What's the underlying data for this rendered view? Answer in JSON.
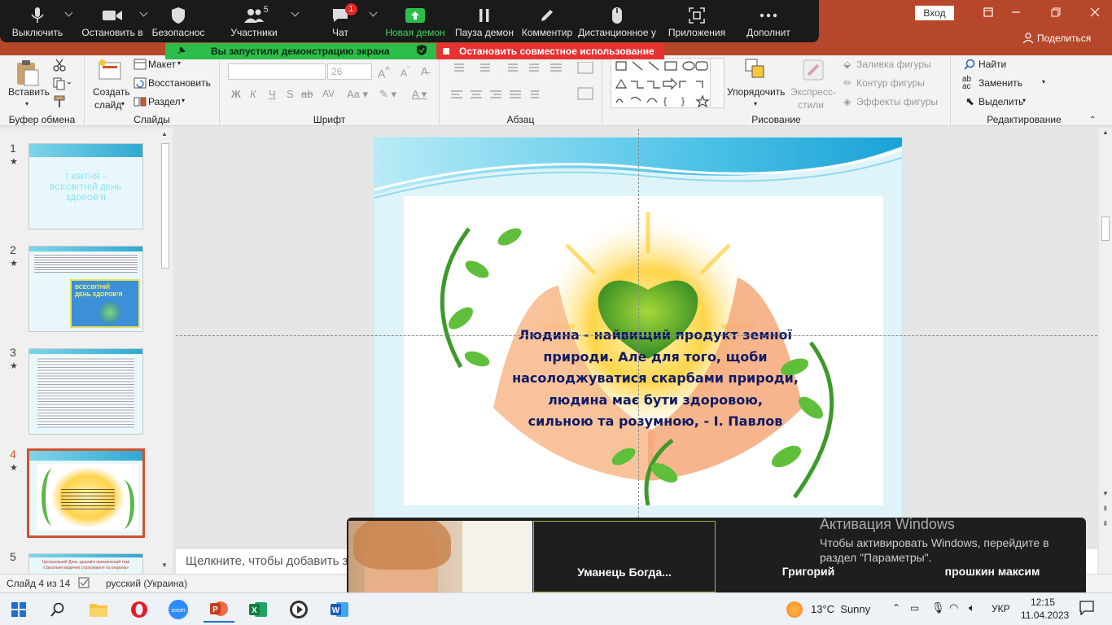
{
  "zoom_toolbar": {
    "items": [
      {
        "label": "Выключить",
        "icon": "microphone-icon"
      },
      {
        "label": "Остановить в",
        "icon": "video-camera-icon"
      },
      {
        "label": "Безопаснос",
        "icon": "shield-icon"
      },
      {
        "label": "Участники",
        "icon": "participants-icon",
        "count": "5"
      },
      {
        "label": "Чат",
        "icon": "chat-icon",
        "badge": "1"
      },
      {
        "label": "Новая демон",
        "icon": "share-screen-icon"
      },
      {
        "label": "Пауза демон",
        "icon": "pause-icon"
      },
      {
        "label": "Комментир",
        "icon": "pencil-icon"
      },
      {
        "label": "Дистанционное у",
        "icon": "mouse-icon"
      },
      {
        "label": "Приложения",
        "icon": "apps-icon"
      },
      {
        "label": "Дополнит",
        "icon": "more-icon"
      }
    ],
    "accent": "#2dbd4a"
  },
  "share_banner": {
    "started": "Вы запустили демонстрацию экрана",
    "stop": "Остановить совместное использование"
  },
  "titlebar": {
    "sign_in": "Вход",
    "share": "Поделиться",
    "color": "#b7472a"
  },
  "ribbon": {
    "clipboard": {
      "paste": "Вставить",
      "label": "Буфер обмена"
    },
    "slides": {
      "new_slide_line1": "Создать",
      "new_slide_line2": "слайд",
      "layout": "Макет",
      "reset": "Восстановить",
      "section": "Раздел",
      "label": "Слайды"
    },
    "font": {
      "size": "26",
      "bold": "Ж",
      "italic": "К",
      "underline": "Ч",
      "strike": "S",
      "label": "Шрифт"
    },
    "paragraph": {
      "label": "Абзац"
    },
    "drawing": {
      "arrange": "Упорядочить",
      "quick_styles_line1": "Экспресс-",
      "quick_styles_line2": "стили",
      "fill": "Заливка фигуры",
      "outline": "Контур фигуры",
      "effects": "Эффекты фигуры",
      "label": "Рисование"
    },
    "editing": {
      "find": "Найти",
      "replace": "Заменить",
      "select": "Выделить",
      "label": "Редактирование"
    }
  },
  "thumbnails": [
    {
      "number": "1",
      "title": "7 КВІТНЯ – ВСЕСВІТНІЙ ДЕНЬ ЗДОРОВ'Я"
    },
    {
      "number": "2",
      "badge_line1": "ВСЕСВІТНІЙ",
      "badge_line2": "ДЕНЬ ЗДОРОВ'Я"
    },
    {
      "number": "3"
    },
    {
      "number": "4",
      "selected": true
    },
    {
      "number": "5",
      "title": "Центральний День здоров'я присвячений темі «Загальне медичне страхування та охорона»"
    }
  ],
  "slide": {
    "quote_lines": [
      "Людина - найвищий продукт земної",
      "природи. Але для того, щоби",
      "насолоджуватися скарбами природи,",
      "людина має бути здоровою,",
      "сильною та розумною, - І. Павлов"
    ],
    "text_color": "#101a66"
  },
  "notes_placeholder": "Щелкните, чтобы добавить за",
  "status": {
    "slide_info": "Слайд 4 из 14",
    "language": "русский (Украина)"
  },
  "video": {
    "tiles": [
      "Уманець Богда...",
      "Григорий",
      "прошкин максим"
    ]
  },
  "activation": {
    "title": "Активация Windows",
    "line1": "Чтобы активировать Windows, перейдите в",
    "line2": "раздел \"Параметры\"."
  },
  "taskbar": {
    "weather": "13°C  Sunny",
    "lang": "УКР",
    "time": "12:15",
    "date": "11.04.2023"
  }
}
